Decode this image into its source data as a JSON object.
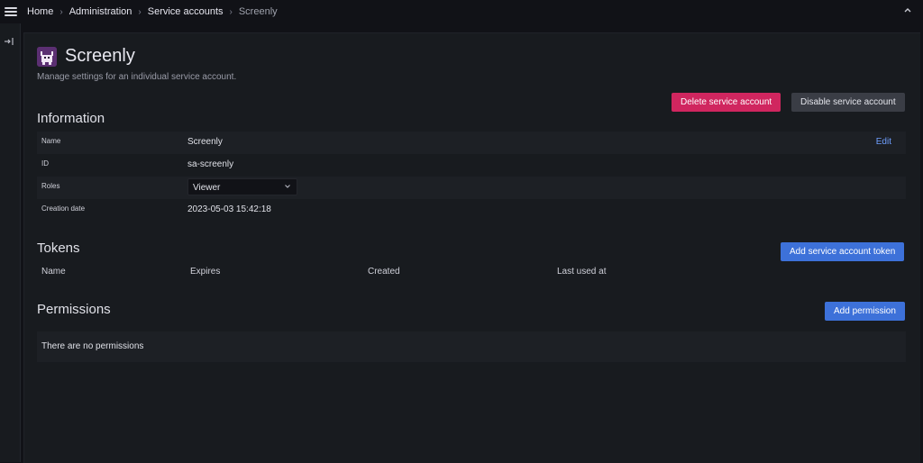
{
  "breadcrumb": [
    "Home",
    "Administration",
    "Service accounts",
    "Screenly"
  ],
  "page": {
    "title": "Screenly",
    "subtitle": "Manage settings for an individual service account."
  },
  "actions": {
    "delete_label": "Delete service account",
    "disable_label": "Disable service account"
  },
  "information": {
    "heading": "Information",
    "rows": [
      {
        "label": "Name",
        "value": "Screenly"
      },
      {
        "label": "ID",
        "value": "sa-screenly"
      },
      {
        "label": "Roles",
        "value": "Viewer"
      },
      {
        "label": "Creation date",
        "value": "2023-05-03 15:42:18"
      }
    ],
    "edit_label": "Edit"
  },
  "tokens": {
    "heading": "Tokens",
    "add_label": "Add service account token",
    "columns": [
      "Name",
      "Expires",
      "Created",
      "Last used at"
    ]
  },
  "permissions": {
    "heading": "Permissions",
    "add_label": "Add permission",
    "empty_text": "There are no permissions"
  },
  "colors": {
    "background": "#111217",
    "panel": "#181b1f",
    "danger": "#d0265f",
    "primary": "#3d71d9",
    "secondary": "#3a3d45",
    "link": "#6e9fff"
  },
  "icons": {
    "menu": "hamburger-icon",
    "dock": "dock-icon",
    "collapse": "chevron-up-icon",
    "select": "chevron-down-icon",
    "avatar": "robot-avatar"
  }
}
